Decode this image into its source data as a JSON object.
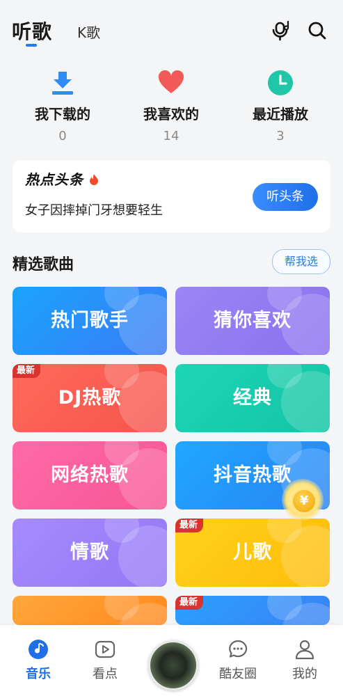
{
  "header": {
    "tab_active": "听歌",
    "tab_k": "K歌"
  },
  "stats": [
    {
      "label": "我下载的",
      "count": "0",
      "icon": "download-icon"
    },
    {
      "label": "我喜欢的",
      "count": "14",
      "icon": "heart-icon"
    },
    {
      "label": "最近播放",
      "count": "3",
      "icon": "clock-icon"
    }
  ],
  "hot": {
    "title": "热点头条",
    "headline": "女子因摔掉门牙想要轻生",
    "button": "听头条"
  },
  "section": {
    "title": "精选歌曲",
    "help_button": "帮我选"
  },
  "tiles": [
    {
      "label": "热门歌手",
      "badge": "",
      "color_from": "#1aa3ff",
      "color_to": "#3a7bf5"
    },
    {
      "label": "猜你喜欢",
      "badge": "",
      "color_from": "#9a86f5",
      "color_to": "#8a70ef"
    },
    {
      "label": "DJ热歌",
      "badge": "最新",
      "color_from": "#ff6a5a",
      "color_to": "#f4544c"
    },
    {
      "label": "经典",
      "badge": "",
      "color_from": "#1dd6b6",
      "color_to": "#12c3a4"
    },
    {
      "label": "网络热歌",
      "badge": "",
      "color_from": "#ff6aa8",
      "color_to": "#f75593"
    },
    {
      "label": "抖音热歌",
      "badge": "",
      "color_from": "#1fa8ff",
      "color_to": "#2a83f5"
    },
    {
      "label": "情歌",
      "badge": "",
      "color_from": "#a58bff",
      "color_to": "#9377f5"
    },
    {
      "label": "儿歌",
      "badge": "最新",
      "color_from": "#ffd21a",
      "color_to": "#ffbb0a"
    },
    {
      "label": "",
      "badge": "",
      "color_from": "#ffa63a",
      "color_to": "#ff8a1f"
    },
    {
      "label": "",
      "badge": "最新",
      "color_from": "#2aa0ff",
      "color_to": "#3b82f5"
    }
  ],
  "coin": {
    "symbol": "¥"
  },
  "bottom_nav": [
    {
      "label": "音乐",
      "active": true,
      "icon": "music-note-icon"
    },
    {
      "label": "看点",
      "active": false,
      "icon": "play-video-icon"
    },
    {
      "label": "",
      "active": false,
      "icon": "now-playing-disc"
    },
    {
      "label": "酷友圈",
      "active": false,
      "icon": "chat-bubble-icon"
    },
    {
      "label": "我的",
      "active": false,
      "icon": "user-icon"
    }
  ]
}
